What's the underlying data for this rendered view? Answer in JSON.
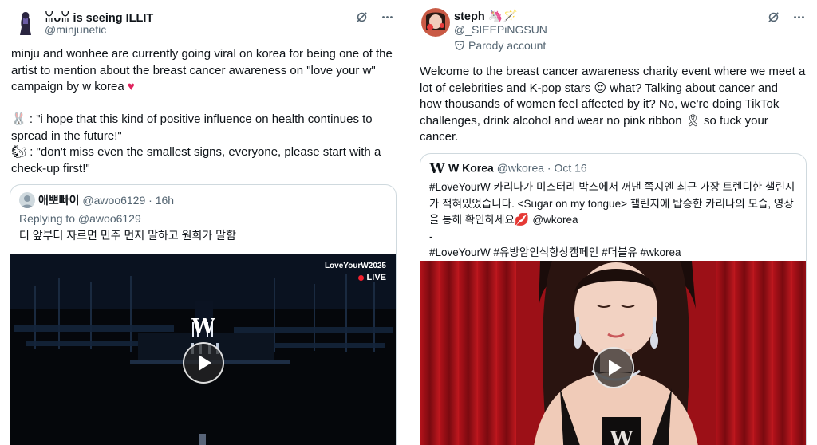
{
  "left": {
    "display_name": "ꈍᴗꈍ is seeing ILLIT",
    "handle": "@minjunetic",
    "body_lines": [
      "minju and wonhee are currently going viral on korea for being one of the",
      "artist to mention about the breast cancer awareness on \"love your w\"",
      "campaign by w korea"
    ],
    "quote_line_1": ": \"i hope that this kind of positive influence on health continues to",
    "quote_line_2": "spread in the future!\"",
    "quote_line_3": ": \"don't miss even the smallest signs, everyone, please start with a",
    "quote_line_4": "check-up first!\"",
    "quoted": {
      "name": "애뽀빠이",
      "meta": "@awoo6129 · 16h",
      "replying": "Replying to @awoo6129",
      "text": "더 앞부터 자르면 민주 먼저 말하고 원희가 말함",
      "video_tag": "LoveYourW2025",
      "live_label": "LIVE"
    }
  },
  "right": {
    "display_name": "steph",
    "handle": "@_SIEEPiNGSUN",
    "parody_label": "Parody account",
    "body_lines": [
      "Welcome to the breast cancer awareness charity event where we meet a",
      "lot of celebrities and K-pop stars",
      "what? Talking about cancer and",
      "how thousands of women feel affected by it? No, we're doing TikTok",
      "challenges, drink alcohol and wear no pink ribbon",
      "so fuck your",
      "cancer."
    ],
    "quoted": {
      "name": "W Korea",
      "meta": "@wkorea · Oct 16",
      "text_lines": [
        "#LoveYourW 카리나가 미스터리 박스에서 꺼낸 쪽지엔 최근 가장 트렌디한 챌린지",
        "가 적혀있었습니다. <Sugar on my tongue> 챌린지에 탑승한 카리나의 모습, 영상",
        "을 통해 확인하세요",
        "@wkorea",
        "-",
        "#LoveYourW #유방암인식향상캠페인 #더블유 #wkorea"
      ]
    }
  },
  "colors": {
    "text": "#0f1419",
    "muted": "#536471",
    "border": "#cfd9de",
    "live_red": "#f4212e"
  },
  "icons": [
    "grok-icon",
    "more-icon",
    "play-icon",
    "heart-emoji",
    "ribbon-emoji",
    "heart-eyes-emoji",
    "lips-emoji",
    "rabbit-emoji",
    "squirrel-emoji",
    "unicorn-emoji",
    "wand-emoji",
    "w-logo-icon",
    "parody-mask-icon"
  ]
}
